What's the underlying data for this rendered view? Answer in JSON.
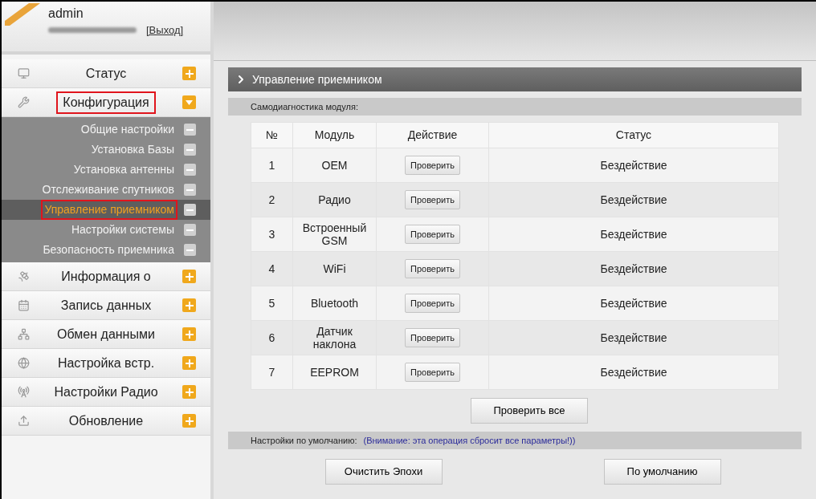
{
  "user": {
    "name": "admin",
    "logout": "[Выход]"
  },
  "menu": [
    {
      "label": "Статус",
      "kind": "monitor",
      "expanded": false,
      "highlighted": false
    },
    {
      "label": "Конфигурация",
      "kind": "tools",
      "expanded": true,
      "highlighted": true,
      "children": [
        {
          "label": "Общие настройки",
          "selected": false,
          "highlighted": false
        },
        {
          "label": "Установка Базы",
          "selected": false,
          "highlighted": false
        },
        {
          "label": "Установка антенны",
          "selected": false,
          "highlighted": false
        },
        {
          "label": "Отслеживание спутников",
          "selected": false,
          "highlighted": false
        },
        {
          "label": "Управление приемником",
          "selected": true,
          "highlighted": true
        },
        {
          "label": "Настройки системы",
          "selected": false,
          "highlighted": false
        },
        {
          "label": "Безопасность приемника",
          "selected": false,
          "highlighted": false
        }
      ]
    },
    {
      "label": "Информация о",
      "kind": "satellite",
      "expanded": false,
      "highlighted": false
    },
    {
      "label": "Запись данных",
      "kind": "calendar",
      "expanded": false,
      "highlighted": false
    },
    {
      "label": "Обмен данными",
      "kind": "network",
      "expanded": false,
      "highlighted": false
    },
    {
      "label": "Настройка встр.",
      "kind": "globe",
      "expanded": false,
      "highlighted": false
    },
    {
      "label": "Настройки Радио",
      "kind": "radio",
      "expanded": false,
      "highlighted": false
    },
    {
      "label": "Обновление",
      "kind": "upload",
      "expanded": false,
      "highlighted": false
    }
  ],
  "page_title": "Управление приемником",
  "self_test": {
    "label": "Самодиагностика модуля:",
    "columns": [
      "№",
      "Модуль",
      "Действие",
      "Статус"
    ],
    "rows": [
      {
        "no": "1",
        "module": "OEM",
        "action": "Проверить",
        "status": "Бездействие"
      },
      {
        "no": "2",
        "module": "Радио",
        "action": "Проверить",
        "status": "Бездействие"
      },
      {
        "no": "3",
        "module": "Встроенный GSM",
        "action": "Проверить",
        "status": "Бездействие"
      },
      {
        "no": "4",
        "module": "WiFi",
        "action": "Проверить",
        "status": "Бездействие"
      },
      {
        "no": "5",
        "module": "Bluetooth",
        "action": "Проверить",
        "status": "Бездействие"
      },
      {
        "no": "6",
        "module": "Датчик наклона",
        "action": "Проверить",
        "status": "Бездействие"
      },
      {
        "no": "7",
        "module": "EEPROM",
        "action": "Проверить",
        "status": "Бездействие"
      }
    ],
    "check_all": "Проверить все"
  },
  "defaults": {
    "label": "Настройки по умолчанию:",
    "warning": "(Внимание: эта операция сбросит все параметры!))",
    "buttons": [
      "Очистить Эпохи",
      "По умолчанию"
    ]
  }
}
